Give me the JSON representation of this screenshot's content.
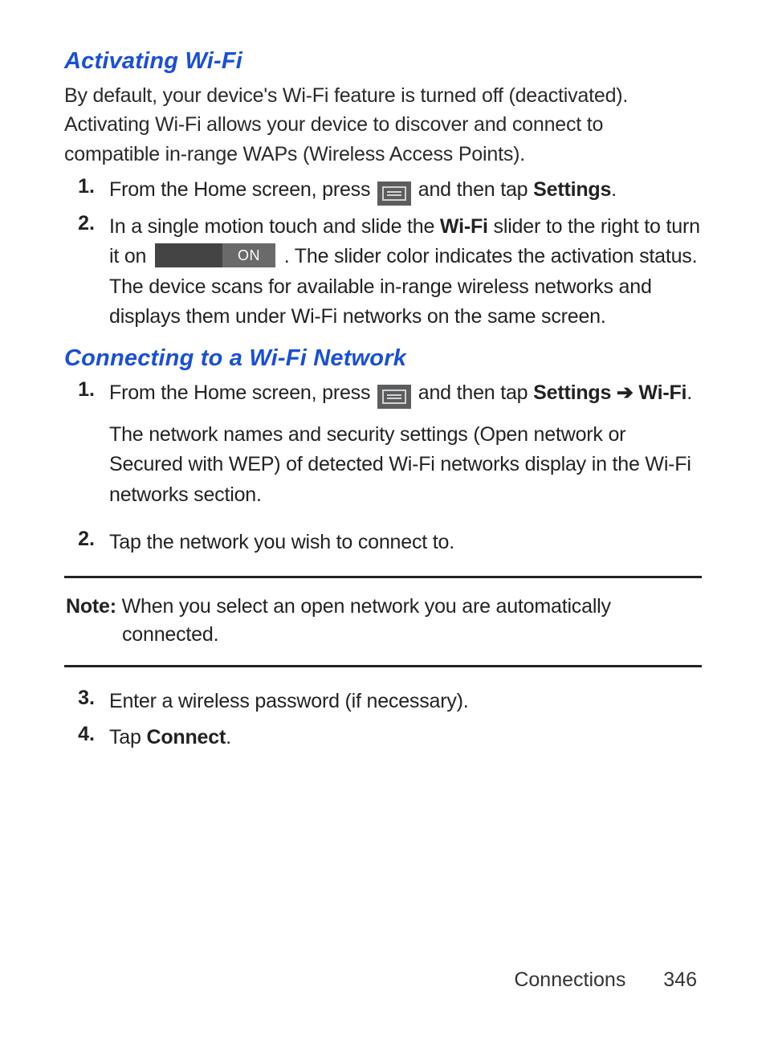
{
  "sections": {
    "s1_title": "Activating Wi-Fi",
    "s1_intro": "By default, your device's Wi-Fi feature is turned off (deactivated). Activating Wi-Fi allows your device to discover and connect to compatible in-range WAPs (Wireless Access Points).",
    "s2_title": "Connecting to a Wi-Fi Network"
  },
  "s1_steps": {
    "n1": "1.",
    "n2": "2.",
    "t1a": "From the Home screen, press ",
    "t1b": " and then tap ",
    "t1c": "Settings",
    "t1d": ".",
    "t2a": "In a single motion touch and slide the ",
    "t2b": "Wi-Fi",
    "t2c": " slider to the right to turn it on ",
    "t2d": ". The slider color indicates the activation status. The device scans for available in-range wireless networks and displays them under Wi-Fi networks on the same screen."
  },
  "s2_steps": {
    "n1": "1.",
    "n2": "2.",
    "n3": "3.",
    "n4": "4.",
    "t1a": "From the Home screen, press ",
    "t1b": " and then tap ",
    "t1c": "Settings",
    "t1d": " ➔ ",
    "t1e": "Wi-Fi",
    "t1f": ".",
    "t1g": "The network names and security settings (Open network or Secured with WEP) of detected Wi-Fi networks display in the Wi-Fi networks section.",
    "t2": "Tap the network you wish to connect to.",
    "t3": "Enter a wireless password (if necessary).",
    "t4a": "Tap ",
    "t4b": "Connect",
    "t4c": "."
  },
  "note": {
    "label": "Note:",
    "text": " When you select an open network you are automatically connected."
  },
  "slider": {
    "label": "ON"
  },
  "footer": {
    "section": "Connections",
    "page": "346"
  }
}
